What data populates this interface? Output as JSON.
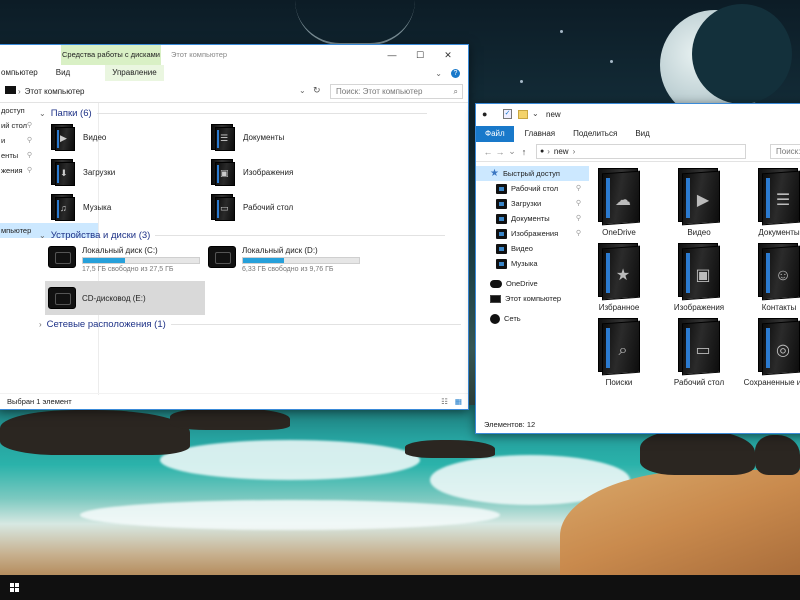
{
  "colors": {
    "accent": "#1979ca",
    "drive_bar": "#26a0da",
    "section_heading": "#1e3287"
  },
  "left_window": {
    "context_tab": "Средства работы с дисками",
    "title": "Этот компьютер",
    "ribbon_tabs": [
      "омпьютер",
      "Вид",
      "Управление"
    ],
    "address": "Этот компьютер",
    "search_placeholder": "Поиск: Этот компьютер",
    "nav_items": [
      {
        "label": "доступ",
        "pinned": false,
        "selected": false
      },
      {
        "label": "ий стол",
        "pinned": true,
        "selected": false
      },
      {
        "label": "и",
        "pinned": true,
        "selected": false
      },
      {
        "label": "енты",
        "pinned": true,
        "selected": false
      },
      {
        "label": "жения",
        "pinned": true,
        "selected": false
      },
      {
        "label": "",
        "pinned": false,
        "selected": false
      },
      {
        "label": "",
        "pinned": false,
        "selected": false
      },
      {
        "label": "",
        "pinned": false,
        "selected": false
      },
      {
        "label": "мпьютер",
        "pinned": false,
        "selected": true
      }
    ],
    "folders_heading": "Папки (6)",
    "folders": [
      {
        "label": "Видео",
        "icon": "video-folder-icon",
        "glyph": "▶"
      },
      {
        "label": "Документы",
        "icon": "documents-folder-icon",
        "glyph": "☰"
      },
      {
        "label": "Загрузки",
        "icon": "downloads-folder-icon",
        "glyph": "⬇"
      },
      {
        "label": "Изображения",
        "icon": "pictures-folder-icon",
        "glyph": "▣"
      },
      {
        "label": "Музыка",
        "icon": "music-folder-icon",
        "glyph": "♫"
      },
      {
        "label": "Рабочий стол",
        "icon": "desktop-folder-icon",
        "glyph": "▭"
      }
    ],
    "devices_heading": "Устройства и диски (3)",
    "drives": [
      {
        "name": "Локальный диск (C:)",
        "free": "17,5 ГБ свободно из 27,5 ГБ",
        "used_fraction": 0.36
      },
      {
        "name": "Локальный диск (D:)",
        "free": "6,33 ГБ свободно из 9,76 ГБ",
        "used_fraction": 0.35
      },
      {
        "name": "CD-дисковод (E:)",
        "free": "",
        "used_fraction": null
      }
    ],
    "network_heading": "Сетевые расположения (1)",
    "status": "Выбран 1 элемент"
  },
  "right_window": {
    "title": "new",
    "ribbon_tabs": [
      "Файл",
      "Главная",
      "Поделиться",
      "Вид"
    ],
    "address": "new",
    "search_placeholder": "Поиск: new",
    "nav_items": [
      {
        "label": "Быстрый доступ",
        "icon": "star-icon",
        "pinned": false,
        "selected": true
      },
      {
        "label": "Рабочий стол",
        "icon": "folder-icon",
        "pinned": true,
        "selected": false
      },
      {
        "label": "Загрузки",
        "icon": "folder-icon",
        "pinned": true,
        "selected": false
      },
      {
        "label": "Документы",
        "icon": "folder-icon",
        "pinned": true,
        "selected": false
      },
      {
        "label": "Изображения",
        "icon": "folder-icon",
        "pinned": true,
        "selected": false
      },
      {
        "label": "Видео",
        "icon": "folder-icon",
        "pinned": false,
        "selected": false
      },
      {
        "label": "Музыка",
        "icon": "folder-icon",
        "pinned": false,
        "selected": false
      },
      {
        "label": "OneDrive",
        "icon": "cloud-icon",
        "pinned": false,
        "selected": false
      },
      {
        "label": "Этот компьютер",
        "icon": "computer-icon",
        "pinned": false,
        "selected": false
      },
      {
        "label": "Сеть",
        "icon": "network-icon",
        "pinned": false,
        "selected": false
      }
    ],
    "tiles": [
      {
        "label": "OneDrive",
        "glyph": "☁"
      },
      {
        "label": "Видео",
        "glyph": "▶"
      },
      {
        "label": "Документы",
        "glyph": "☰"
      },
      {
        "label": "Избранное",
        "glyph": "★"
      },
      {
        "label": "Изображения",
        "glyph": "▣"
      },
      {
        "label": "Контакты",
        "glyph": "☺"
      },
      {
        "label": "Поиски",
        "glyph": "⌕"
      },
      {
        "label": "Рабочий стол",
        "glyph": "▭"
      },
      {
        "label": "Сохраненные игры",
        "glyph": "◎"
      }
    ],
    "status": "Элементов: 12"
  }
}
